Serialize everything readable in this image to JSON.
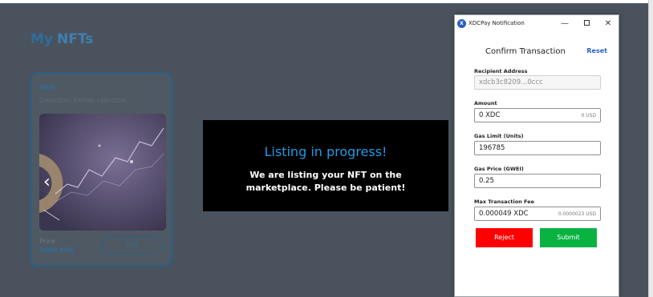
{
  "page": {
    "heading_part1": "My",
    "heading_part2": "NFTs"
  },
  "nft_card": {
    "name": "XFM",
    "collection": "Collection: XinFam collection",
    "price_label": "Price",
    "price_value": "1000 XDC",
    "list_label": "List"
  },
  "overlay": {
    "title": "Listing in progress!",
    "message": "We are listing your NFT on the marketplace. Please be patient!"
  },
  "notification": {
    "window_title": "XDCPay Notification",
    "app_icon_letter": "X",
    "minimize_glyph": "—",
    "close_glyph": "✕",
    "heading": "Confirm Transaction",
    "reset_label": "Reset",
    "recipient_label": "Recipient Address",
    "recipient_value": "xdcb3c8209...0ccc",
    "amount_label": "Amount",
    "amount_value": "0 XDC",
    "amount_usd": "0 USD",
    "gas_limit_label": "Gas Limit (Units)",
    "gas_limit_value": "196785",
    "gas_price_label": "Gas Price (GWEI)",
    "gas_price_value": "0.25",
    "max_fee_label": "Max Transaction Fee",
    "max_fee_value": "0.000049 XDC",
    "max_fee_usd": "0.0000023 USD",
    "reject_label": "Reject",
    "submit_label": "Submit"
  },
  "colors": {
    "backdrop": "#4a535d",
    "accent_blue": "#1e9be6",
    "reject_red": "#ff0000",
    "submit_green": "#08b342",
    "link_blue": "#2a5fc7"
  }
}
